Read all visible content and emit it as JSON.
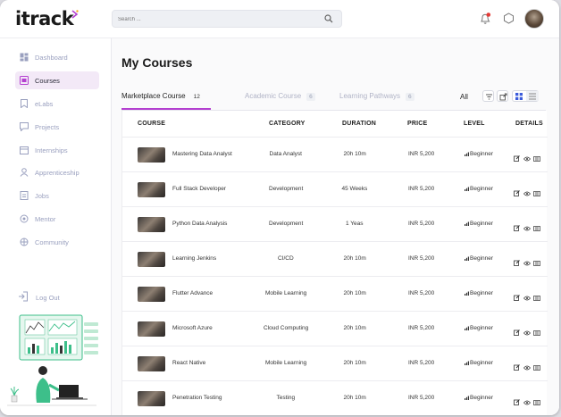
{
  "app": {
    "logo_text": "itrack"
  },
  "header": {
    "search_placeholder": "Search ..."
  },
  "sidebar": {
    "items": [
      {
        "label": "Dashboard",
        "icon": "dashboard-icon",
        "active": false
      },
      {
        "label": "Courses",
        "icon": "courses-icon",
        "active": true
      },
      {
        "label": "eLabs",
        "icon": "elabs-icon",
        "active": false
      },
      {
        "label": "Projects",
        "icon": "projects-icon",
        "active": false
      },
      {
        "label": "Internships",
        "icon": "internships-icon",
        "active": false
      },
      {
        "label": "Apprenticeship",
        "icon": "apprenticeship-icon",
        "active": false
      },
      {
        "label": "Jobs",
        "icon": "jobs-icon",
        "active": false
      },
      {
        "label": "Mentor",
        "icon": "mentor-icon",
        "active": false
      },
      {
        "label": "Community",
        "icon": "community-icon",
        "active": false
      }
    ],
    "logout_label": "Log Out"
  },
  "main": {
    "title": "My Courses",
    "tabs": [
      {
        "label": "Marketplace Course",
        "count": "12",
        "active": true
      },
      {
        "label": "Academic Course",
        "count": "6",
        "active": false
      },
      {
        "label": "Learning Pathways",
        "count": "6",
        "active": false
      }
    ],
    "filter_label": "All"
  },
  "table": {
    "columns": [
      "COURSE",
      "CATEGORY",
      "DURATION",
      "PRICE",
      "LEVEL",
      "DETAILS"
    ],
    "rows": [
      {
        "course": "Mastering Data Analyst",
        "category": "Data Analyst",
        "duration": "20h 10m",
        "price": "INR 5,200",
        "level": "Beginner"
      },
      {
        "course": "Full Stack Developer",
        "category": "Development",
        "duration": "45 Weeks",
        "price": "INR 5,200",
        "level": "Beginner"
      },
      {
        "course": "Python Data Analysis",
        "category": "Development",
        "duration": "1 Yeas",
        "price": "INR 5,200",
        "level": "Beginner"
      },
      {
        "course": "Learning Jenkins",
        "category": "CI/CD",
        "duration": "20h 10m",
        "price": "INR 5,200",
        "level": "Beginner"
      },
      {
        "course": "Flutter Advance",
        "category": "Mobile Learning",
        "duration": "20h 10m",
        "price": "INR 5,200",
        "level": "Beginner"
      },
      {
        "course": "Microsoft Azure",
        "category": "Cloud Computing",
        "duration": "20h 10m",
        "price": "INR 5,200",
        "level": "Beginner"
      },
      {
        "course": "React Native",
        "category": "Mobile Learning",
        "duration": "20h 10m",
        "price": "INR 5,200",
        "level": "Beginner"
      },
      {
        "course": "Penetration Testing",
        "category": "Testing",
        "duration": "20h 10m",
        "price": "INR 5,200",
        "level": "Beginner"
      }
    ]
  },
  "colors": {
    "accent": "#b43fd0",
    "active_nav_bg": "#f3e9f7",
    "notification_dot": "#e53935",
    "illustration_green": "#3dbf8a"
  }
}
